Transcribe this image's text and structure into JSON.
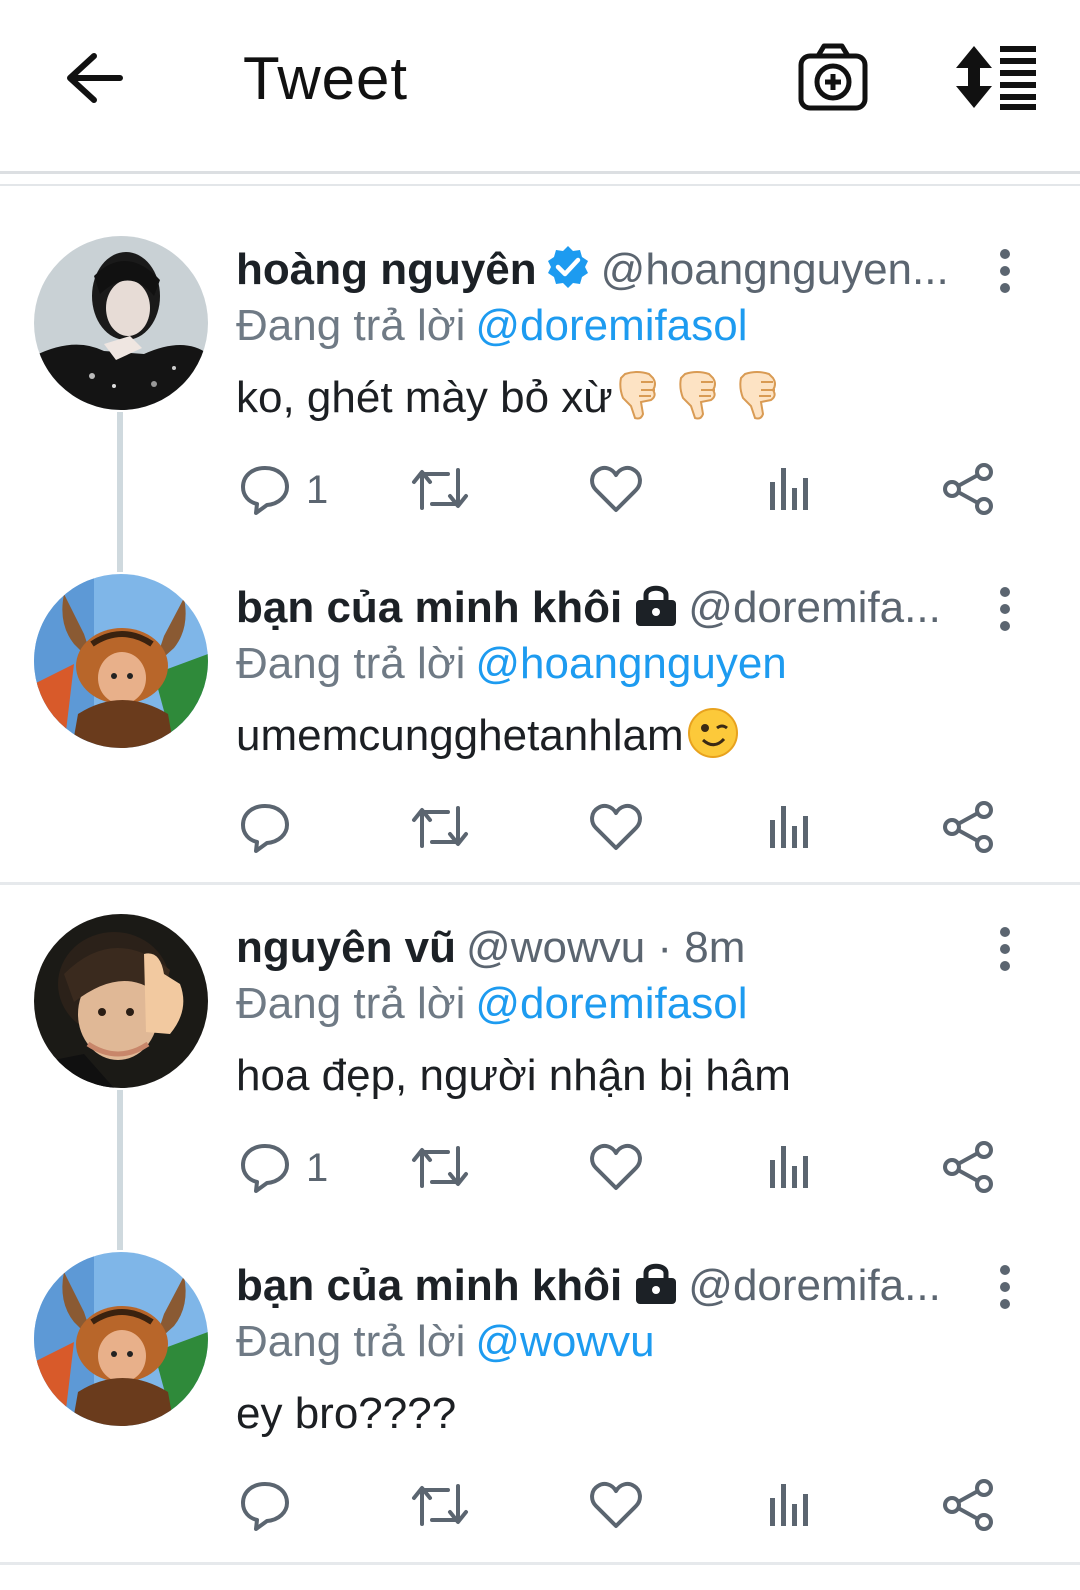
{
  "header": {
    "title": "Tweet",
    "back_icon": "arrow-left-icon",
    "camera_icon": "camera-plus-icon",
    "sort_icon": "sort-list-icon"
  },
  "colors": {
    "accent": "#1d9bf0",
    "text": "#0f1419",
    "secondary": "#5b6570",
    "divider": "#e6e9ec",
    "thread": "#cfd9de"
  },
  "tweets": [
    {
      "name": "hoàng nguyên",
      "badge": "verified-icon",
      "handle": "@hoangnguyen...",
      "replying_label": "Đang trả lời",
      "mention": "@doremifasol",
      "text": "ko, ghét mày bỏ xừ",
      "emoji": [
        "thumbs-down-icon",
        "thumbs-down-icon",
        "thumbs-down-icon"
      ],
      "reply_count": "1"
    },
    {
      "name": "bạn của minh khôi",
      "badge": "lock-icon",
      "handle": "@doremifa...",
      "replying_label": "Đang trả lời",
      "mention": "@hoangnguyen",
      "text": "umemcungghetanhlam",
      "emoji": [
        "winking-face-icon"
      ],
      "reply_count": ""
    },
    {
      "name": "nguyên vũ",
      "badge": "",
      "handle": "@wowvu · 8m",
      "replying_label": "Đang trả lời",
      "mention": "@doremifasol",
      "text": "hoa đẹp, người nhận bị hâm",
      "emoji": [],
      "reply_count": "1"
    },
    {
      "name": "bạn của minh khôi",
      "badge": "lock-icon",
      "handle": "@doremifa...",
      "replying_label": "Đang trả lời",
      "mention": "@wowvu",
      "text": "ey bro????",
      "emoji": [],
      "reply_count": ""
    }
  ]
}
